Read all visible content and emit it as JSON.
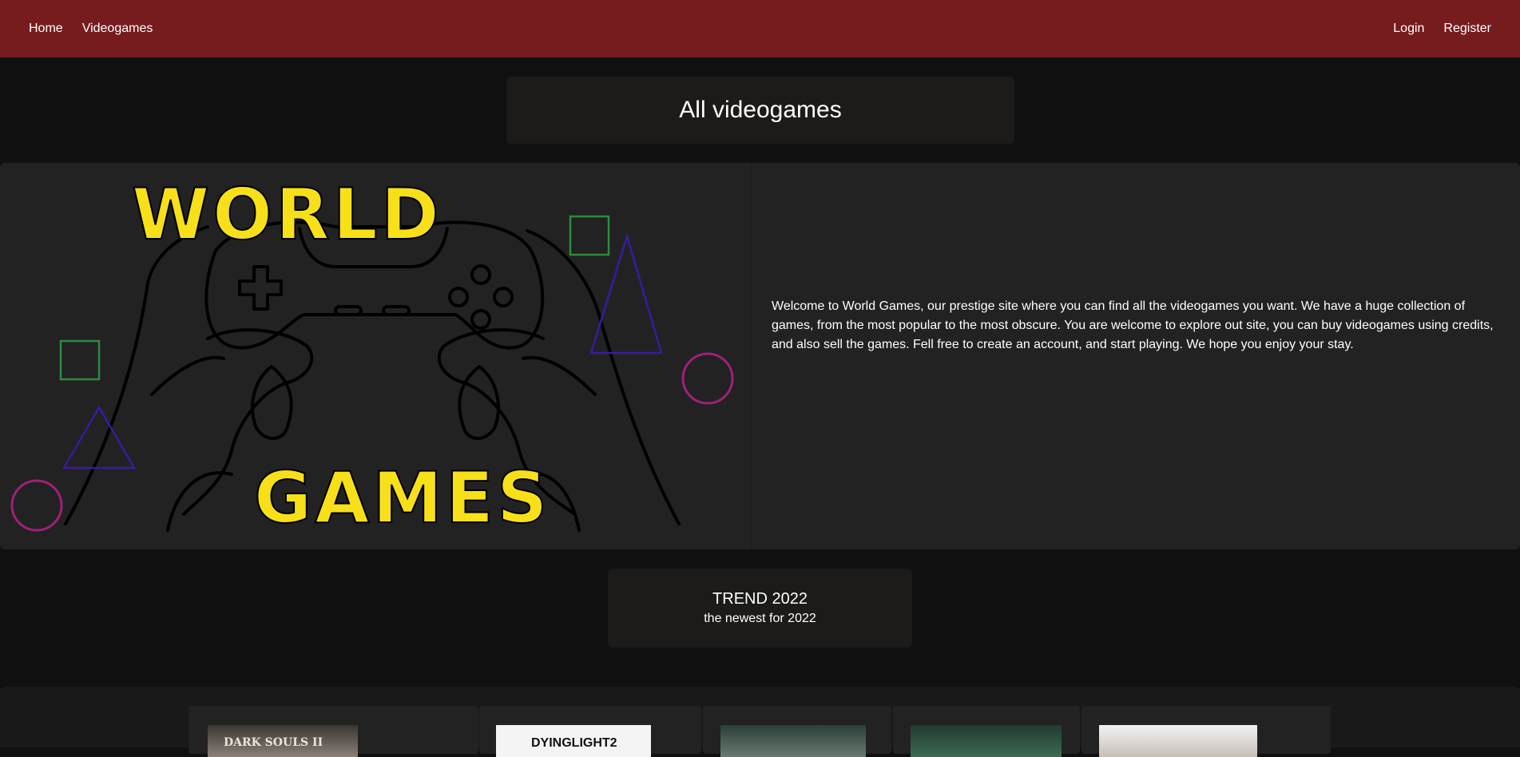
{
  "nav": {
    "left": [
      "Home",
      "Videogames"
    ],
    "right": [
      "Login",
      "Register"
    ]
  },
  "page_title": "All videogames",
  "hero": {
    "logo_top": "WORLD",
    "logo_bottom": "GAMES",
    "description": "Welcome to World Games, our prestige site where you can find all the videogames you want. We have a huge collection of games, from the most popular to the most obscure. You are welcome to explore out site, you can buy videogames using credits, and also sell the games. Fell free to create an account, and start playing. We hope you enjoy your stay."
  },
  "trend": {
    "title": "TREND 2022",
    "subtitle": "the newest for 2022"
  },
  "games": [
    {
      "cover_text": "DARK SOULS II"
    },
    {
      "cover_text": "DYINGLIGHT2"
    },
    {
      "cover_text": ""
    },
    {
      "cover_text": ""
    },
    {
      "cover_text": ""
    }
  ],
  "colors": {
    "navbar": "#761c1e",
    "background": "#101010",
    "card": "#1c1b1a",
    "hero": "#222222",
    "logo_yellow": "#f7e01a",
    "shape_green": "#2e8b3d",
    "shape_purple": "#3a1aa0",
    "shape_magenta": "#a0207a"
  }
}
